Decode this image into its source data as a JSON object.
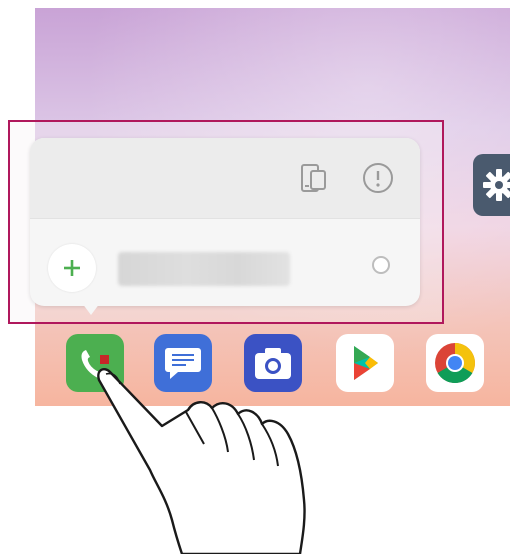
{
  "screen": {
    "popup": {
      "shortcuts_label": "",
      "add_button": "add-icon",
      "icons": [
        "widgets-icon",
        "info-icon"
      ]
    },
    "dock": [
      {
        "name": "phone-app",
        "icon": "phone-icon",
        "color": "#4caf50"
      },
      {
        "name": "messages-app",
        "icon": "messages-icon",
        "color": "#3f6fd8"
      },
      {
        "name": "camera-app",
        "icon": "camera-icon",
        "color": "#3b52c4"
      },
      {
        "name": "play-store-app",
        "icon": "play-store-icon",
        "color": "#ffffff"
      },
      {
        "name": "chrome-app",
        "icon": "chrome-icon",
        "color": "#ffffff"
      }
    ],
    "settings_app": {
      "icon": "gear-icon",
      "color": "#4a5a6e"
    },
    "highlight_color": "#b0185c"
  }
}
